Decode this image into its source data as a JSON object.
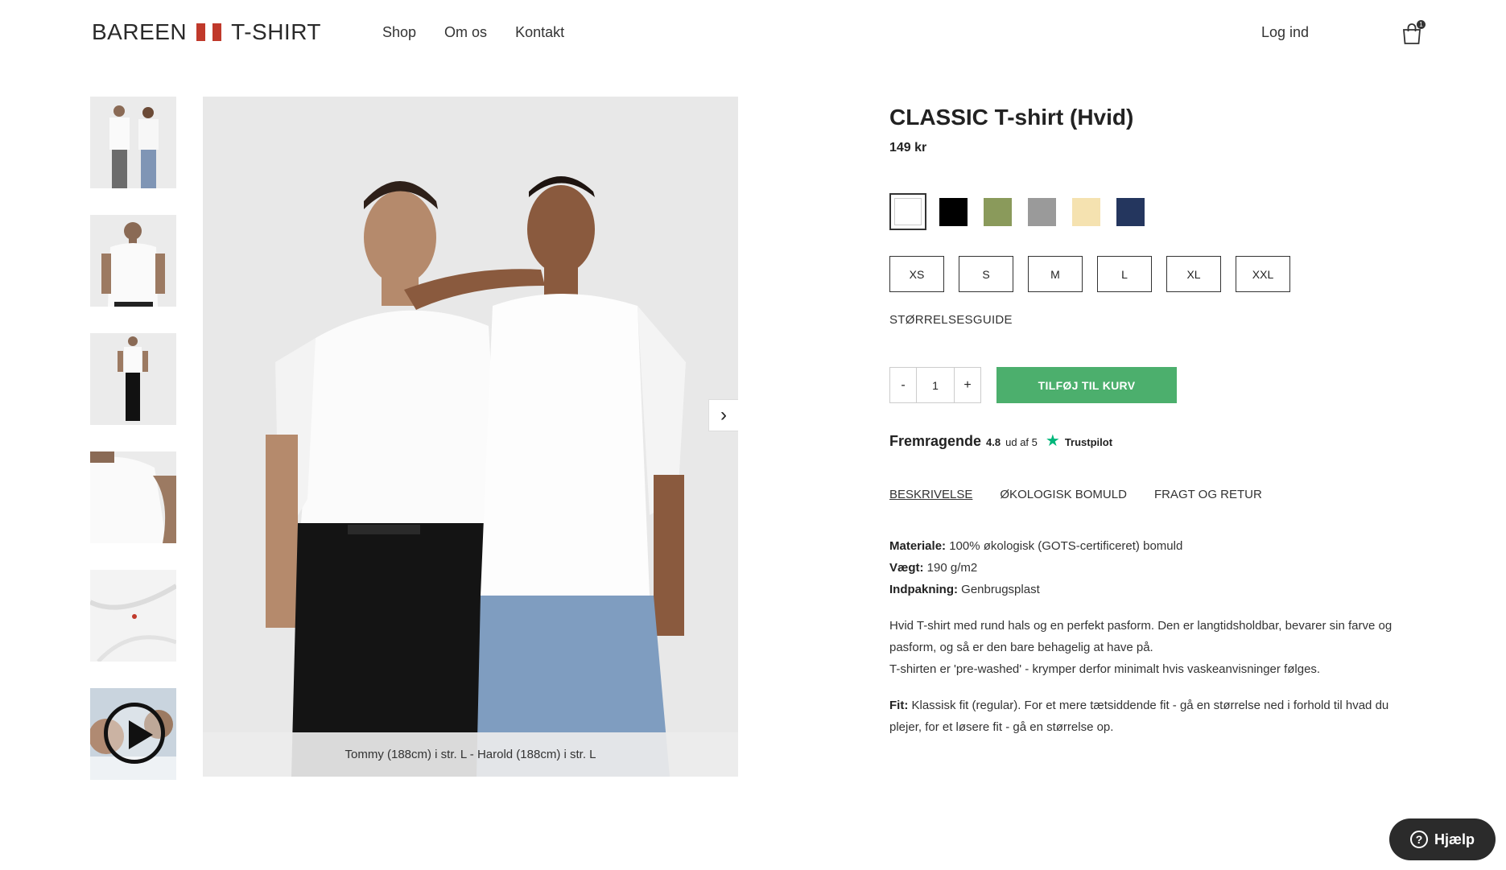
{
  "header": {
    "logo_left": "BAREEN",
    "logo_right": "T-SHIRT",
    "nav": [
      "Shop",
      "Om os",
      "Kontakt"
    ],
    "login": "Log ind",
    "cart_count": "1",
    "cart_icon": "shopping-bag-icon"
  },
  "gallery": {
    "thumbnails": [
      "two-models",
      "front-model",
      "full-body-model",
      "shoulder-detail",
      "fabric-detail",
      "video"
    ],
    "caption": "Tommy (188cm) i str. L - Harold (188cm) i str. L",
    "next_icon": "chevron-right-icon"
  },
  "product": {
    "title": "CLASSIC T-shirt (Hvid)",
    "price": "149 kr",
    "colors": [
      "#ffffff",
      "#000000",
      "#8a9a5b",
      "#9a9a9a",
      "#f5e2b0",
      "#24365e"
    ],
    "selected_color": "#ffffff",
    "sizes": [
      "XS",
      "S",
      "M",
      "L",
      "XL",
      "XXL"
    ],
    "size_guide": "STØRRELSESGUIDE",
    "qty_minus": "-",
    "qty_value": "1",
    "qty_plus": "+",
    "add_to_cart": "TILFØJ TIL KURV",
    "trust": {
      "word": "Fremragende",
      "score": "4.8",
      "out_of": "ud af 5",
      "brand": "Trustpilot",
      "star_color": "#00b67a"
    },
    "tabs": [
      "BESKRIVELSE",
      "ØKOLOGISK BOMULD",
      "FRAGT OG RETUR"
    ],
    "active_tab": "BESKRIVELSE",
    "description": {
      "material_label": "Materiale:",
      "material_value": "100% økologisk (GOTS-certificeret) bomuld",
      "weight_label": "Vægt:",
      "weight_value": "190 g/m2",
      "packaging_label": "Indpakning:",
      "packaging_value": "Genbrugsplast",
      "para1_line1": "Hvid T-shirt med rund hals og en perfekt pasform. Den er langtidsholdbar, bevarer sin farve og pasform, og så er den bare behagelig at have på.",
      "para1_line2": "T-shirten er 'pre-washed' - krymper derfor minimalt hvis vaskeanvisninger følges.",
      "fit_label": "Fit:",
      "fit_value": "Klassisk fit (regular). For et mere tætsiddende fit - gå en størrelse ned i forhold til hvad du plejer, for et løsere fit - gå en størrelse op."
    }
  },
  "help": {
    "label": "Hjælp",
    "icon": "question-icon"
  },
  "colors": {
    "accent_green": "#4caf6d",
    "flag_red": "#c0392b",
    "help_bg": "#2b2b2b"
  }
}
